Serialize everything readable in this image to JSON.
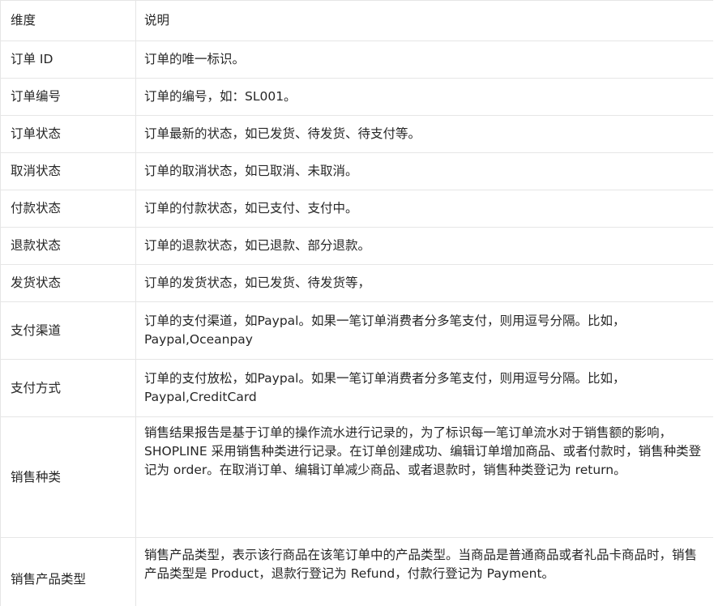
{
  "table": {
    "header": {
      "dimension": "维度",
      "description": "说明"
    },
    "rows": [
      {
        "dimension": "订单 ID",
        "description": "订单的唯一标识。"
      },
      {
        "dimension": "订单编号",
        "description": "订单的编号，如：SL001。"
      },
      {
        "dimension": "订单状态",
        "description": "订单最新的状态，如已发货、待发货、待支付等。"
      },
      {
        "dimension": "取消状态",
        "description": "订单的取消状态，如已取消、未取消。"
      },
      {
        "dimension": "付款状态",
        "description": "订单的付款状态，如已支付、支付中。"
      },
      {
        "dimension": "退款状态",
        "description": "订单的退款状态，如已退款、部分退款。"
      },
      {
        "dimension": "发货状态",
        "description": "订单的发货状态，如已发货、待发货等，"
      },
      {
        "dimension": "支付渠道",
        "description": "订单的支付渠道，如Paypal。如果一笔订单消费者分多笔支付，则用逗号分隔。比如，Paypal,Oceanpay"
      },
      {
        "dimension": "支付方式",
        "description": "订单的支付放松，如Paypal。如果一笔订单消费者分多笔支付，则用逗号分隔。比如，Paypal,CreditCard"
      },
      {
        "dimension": "销售种类",
        "description": "销售结果报告是基于订单的操作流水进行记录的，为了标识每一笔订单流水对于销售额的影响，SHOPLINE 采用销售种类进行记录。在订单创建成功、编辑订单增加商品、或者付款时，销售种类登记为 order。在取消订单、编辑订单减少商品、或者退款时，销售种类登记为 return。"
      },
      {
        "dimension": "销售产品类型",
        "description": "销售产品类型，表示该行商品在该笔订单中的产品类型。当商品是普通商品或者礼品卡商品时，销售产品类型是 Product，退款行登记为 Refund，付款行登记为 Payment。"
      }
    ]
  }
}
